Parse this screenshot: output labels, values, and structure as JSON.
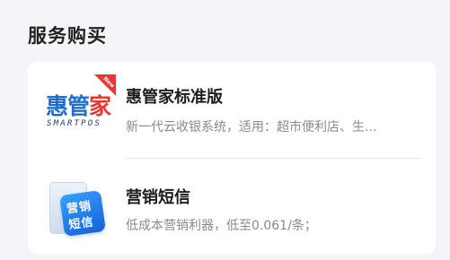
{
  "section": {
    "title": "服务购买"
  },
  "items": [
    {
      "title": "惠管家标准版",
      "description": "新一代云收银系统，适用：超市便利店、生...",
      "logo": {
        "brand_prefix": "惠管",
        "brand_suffix": "家",
        "sub": "SMARTPOS",
        "badge": "New",
        "icon": "huiguanjia-logo-icon"
      }
    },
    {
      "title": "营销短信",
      "description": "低成本营销利器，低至0.061/条；",
      "logo": {
        "line1": "营销",
        "line2": "短信",
        "icon": "sms-marketing-icon"
      }
    }
  ],
  "colors": {
    "brand_blue": "#1d6fd0",
    "badge_red": "#e33",
    "sms_blue": "#2a7ff0"
  }
}
